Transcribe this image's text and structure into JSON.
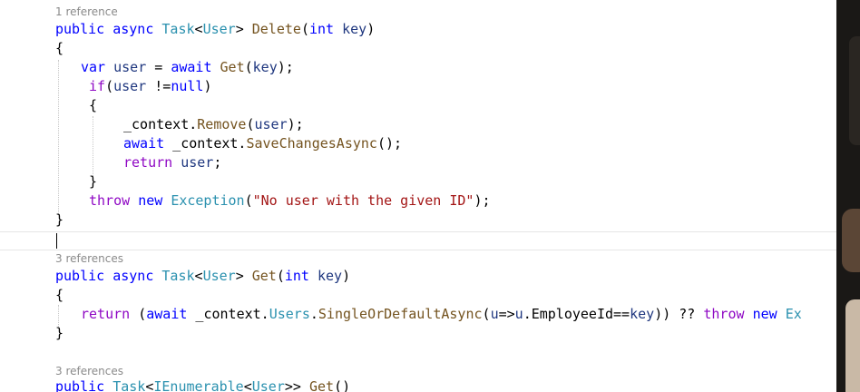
{
  "code_lens": {
    "delete_refs": "1 reference",
    "get_key_refs": "3 references",
    "get_all_refs": "3 references"
  },
  "lines": {
    "l1": {
      "kw1": "public",
      "kw2": "async",
      "ty1": "Task",
      "p1": "<",
      "ty2": "User",
      "p2": "> ",
      "fn": "Delete",
      "p3": "(",
      "kw3": "int",
      "p4": " ",
      "pr": "key",
      "p5": ")"
    },
    "l2": {
      "t": "{"
    },
    "l3": {
      "kw1": "var",
      "p1": " ",
      "pr1": "user",
      "p2": " = ",
      "kw2": "await",
      "p3": " ",
      "fn": "Get",
      "p4": "(",
      "pr2": "key",
      "p5": ");"
    },
    "l4": {
      "cl": "if",
      "p1": "(",
      "pr": "user",
      "p2": " !=",
      "kw": "null",
      "p3": ")"
    },
    "l5": {
      "t": "{"
    },
    "l6": {
      "p1": "_context.",
      "fn": "Remove",
      "p2": "(",
      "pr": "user",
      "p3": ");"
    },
    "l7": {
      "kw": "await",
      "p1": " _context.",
      "fn": "SaveChangesAsync",
      "p2": "();"
    },
    "l8": {
      "cl": "return",
      "p1": " ",
      "pr": "user",
      "p2": ";"
    },
    "l9": {
      "t": "}"
    },
    "l10": {
      "cl": "throw",
      "p1": " ",
      "kw": "new",
      "p2": " ",
      "ty": "Exception",
      "p3": "(",
      "st": "\"No user with the given ID\"",
      "p4": ");"
    },
    "l11": {
      "t": "}"
    },
    "l12": {
      "kw1": "public",
      "kw2": "async",
      "ty1": "Task",
      "p1": "<",
      "ty2": "User",
      "p2": "> ",
      "fn": "Get",
      "p3": "(",
      "kw3": "int",
      "p4": " ",
      "pr": "key",
      "p5": ")"
    },
    "l13": {
      "t": "{"
    },
    "l14": {
      "cl1": "return",
      "p1": " (",
      "kw": "await",
      "p2": " _context.",
      "ty": "Users",
      "p3": ".",
      "fn": "SingleOrDefaultAsync",
      "p4": "(",
      "pr1": "u",
      "p5": "=>",
      "pr2": "u",
      "p6": ".EmployeeId==",
      "pr3": "key",
      "p7": ")) ?? ",
      "cl2": "throw",
      "p8": " ",
      "kw2": "new",
      "p9": " ",
      "ty2": "Ex"
    },
    "l15": {
      "t": "}"
    },
    "l16": {
      "kw1": "public",
      "p1": " ",
      "ty1": "Task",
      "p2": "<",
      "ty2": "IEnumerable",
      "p3": "<",
      "ty3": "User",
      "p4": ">> ",
      "fn": "Get",
      "p5": "()"
    }
  }
}
